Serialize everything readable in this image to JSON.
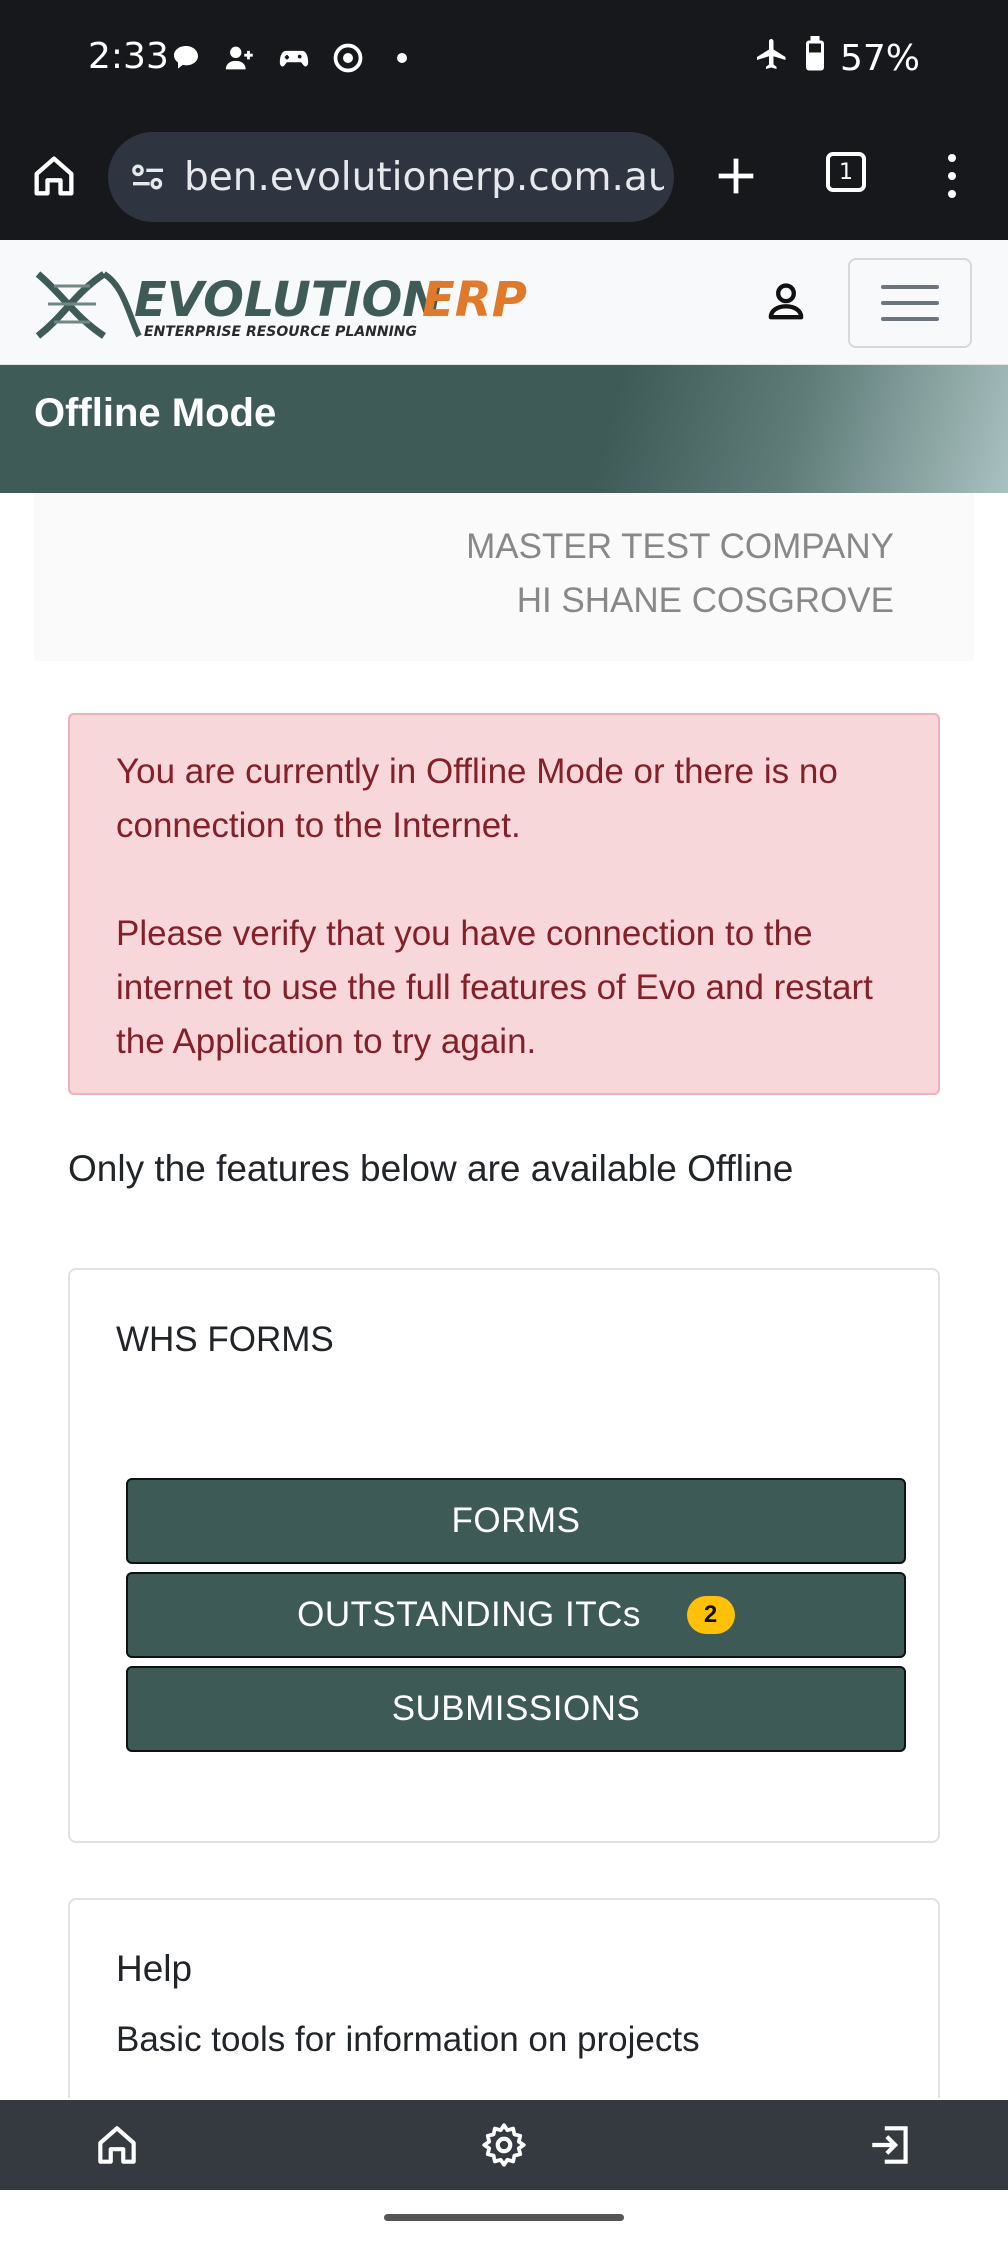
{
  "status_bar": {
    "time": "2:33",
    "battery": "57%",
    "left_icons": [
      "chat-bubble-icon",
      "person-add-icon",
      "gamepad-icon",
      "chrome-icon",
      "dot-icon"
    ],
    "right_icons": [
      "airplane-icon",
      "battery-icon"
    ]
  },
  "browser": {
    "url": "ben.evolutionerp.com.au/",
    "tab_count": "1",
    "icons": [
      "home-icon",
      "tune-icon",
      "plus-icon",
      "tabs-icon",
      "more-vert-icon"
    ]
  },
  "header": {
    "logo_main": "EVOLUTION",
    "logo_accent": "ERP",
    "logo_tagline": "ENTERPRISE RESOURCE PLANNING",
    "brand_color": "#3f5b58",
    "accent_color": "#e07a2a"
  },
  "banner": {
    "title": "Offline Mode"
  },
  "company": {
    "name": "MASTER TEST COMPANY",
    "greeting": "HI SHANE COSGROVE"
  },
  "alert": {
    "line1": "You are currently in Offline Mode or there is no connection to the Internet.",
    "line2": "Please verify that you have connection to the internet to use the full features of Evo and restart the Application to try again."
  },
  "section_heading": "Only the features below are available Offline",
  "whs_card": {
    "title": "WHS FORMS",
    "buttons": [
      {
        "label": "FORMS"
      },
      {
        "label": "OUTSTANDING ITCs",
        "badge": "2"
      },
      {
        "label": "SUBMISSIONS"
      }
    ]
  },
  "help_card": {
    "title": "Help",
    "description": "Basic tools for information on projects"
  },
  "bottom_nav": {
    "items": [
      "home-icon",
      "settings-icon",
      "logout-icon"
    ]
  }
}
